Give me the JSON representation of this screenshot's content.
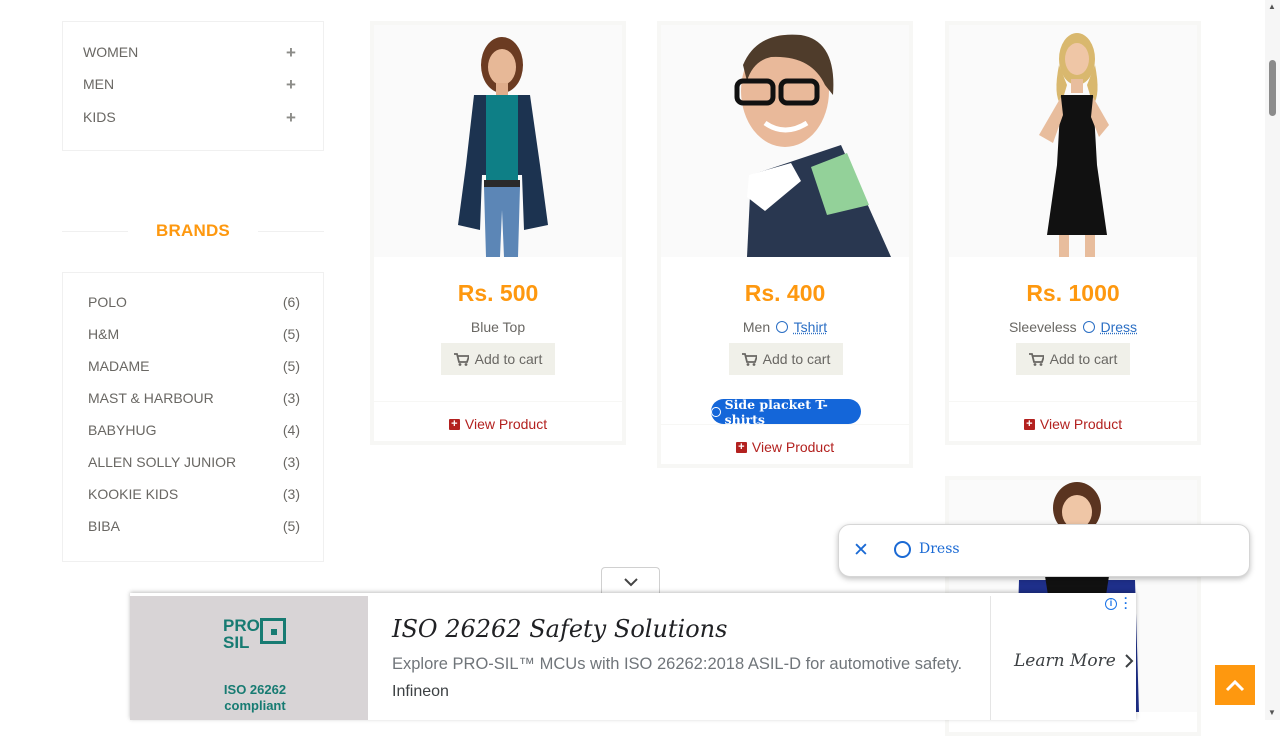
{
  "sidebar": {
    "categories": [
      {
        "label": "WOMEN"
      },
      {
        "label": "MEN"
      },
      {
        "label": "KIDS"
      }
    ],
    "brands_title": "BRANDS",
    "brands": [
      {
        "name": "POLO",
        "count": "(6)"
      },
      {
        "name": "H&M",
        "count": "(5)"
      },
      {
        "name": "MADAME",
        "count": "(5)"
      },
      {
        "name": "MAST & HARBOUR",
        "count": "(3)"
      },
      {
        "name": "BABYHUG",
        "count": "(4)"
      },
      {
        "name": "ALLEN SOLLY JUNIOR",
        "count": "(3)"
      },
      {
        "name": "KOOKIE KIDS",
        "count": "(3)"
      },
      {
        "name": "BIBA",
        "count": "(5)"
      }
    ]
  },
  "products": [
    {
      "price": "Rs. 500",
      "name": "Blue Top",
      "cart_label": "Add to cart",
      "view_label": "View Product"
    },
    {
      "price": "Rs. 400",
      "name_prefix": "Men",
      "name_link": "Tshirt",
      "cart_label": "Add to cart",
      "view_label": "View Product",
      "pill_label": "Side placket T-shirts"
    },
    {
      "price": "Rs. 1000",
      "name_prefix": "Sleeveless",
      "name_link": "Dress",
      "cart_label": "Add to cart",
      "view_label": "View Product"
    }
  ],
  "popup": {
    "label": "Dress"
  },
  "ad": {
    "logo_line1": "PRO",
    "logo_line2": "SIL",
    "logo_caption1": "ISO 26262",
    "logo_caption2": "compliant",
    "headline": "ISO 26262 Safety Solutions",
    "description": "Explore PRO-SIL™ MCUs with ISO 26262:2018 ASIL-D for automotive safety.",
    "sponsor": "Infineon",
    "cta": "Learn More"
  },
  "colors": {
    "accent": "#FE980F",
    "link": "#b3211f",
    "chip_blue": "#1466d9"
  },
  "icons": [
    "plus-icon",
    "cart-icon",
    "plus-square-icon",
    "tag-icon",
    "close-icon",
    "bolt-icon",
    "chevron-down-icon",
    "chevron-right-icon",
    "info-icon",
    "more-icon",
    "chevron-up-icon"
  ]
}
